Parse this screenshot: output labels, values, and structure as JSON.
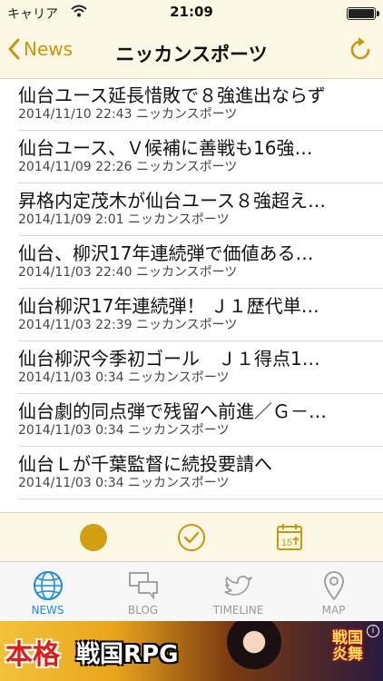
{
  "status": {
    "carrier": "キャリア",
    "time": "21:09"
  },
  "nav": {
    "back_label": "News",
    "title": "ニッカンスポーツ"
  },
  "articles": [
    {
      "headline": "仙台ユース延長惜敗で８強進出ならず",
      "datetime": "2014/11/10 22:43",
      "source": "ニッカンスポーツ"
    },
    {
      "headline": "仙台ユース、Ｖ候補に善戦も16強…",
      "datetime": "2014/11/09 22:26",
      "source": "ニッカンスポーツ"
    },
    {
      "headline": "昇格内定茂木が仙台ユース８強超え…",
      "datetime": "2014/11/09 2:01",
      "source": "ニッカンスポーツ"
    },
    {
      "headline": "仙台、柳沢17年連続弾で価値ある…",
      "datetime": "2014/11/03 22:40",
      "source": "ニッカンスポーツ"
    },
    {
      "headline": "仙台柳沢17年連続弾！ Ｊ１歴代単…",
      "datetime": "2014/11/03 22:39",
      "source": "ニッカンスポーツ"
    },
    {
      "headline": "仙台柳沢今季初ゴール　Ｊ１得点1…",
      "datetime": "2014/11/03 0:34",
      "source": "ニッカンスポーツ"
    },
    {
      "headline": "仙台劇的同点弾で残留へ前進／Ｇ－…",
      "datetime": "2014/11/03 0:34",
      "source": "ニッカンスポーツ"
    },
    {
      "headline": "仙台Ｌが千葉監督に続投要請へ",
      "datetime": "2014/11/03 0:34",
      "source": "ニッカンスポーツ"
    }
  ],
  "toolbar": {
    "calendar_day": "15"
  },
  "tabs": [
    {
      "label": "NEWS",
      "icon": "globe-icon"
    },
    {
      "label": "BLOG",
      "icon": "chat-bubbles-icon"
    },
    {
      "label": "TIMELINE",
      "icon": "twitter-bird-icon"
    },
    {
      "label": "MAP",
      "icon": "map-pin-icon"
    }
  ],
  "ad": {
    "main": "本格",
    "sub": "戦国RPG",
    "logo_line1": "戦国",
    "logo_line2": "炎舞"
  },
  "colors": {
    "accent": "#c9960d",
    "tab_active": "#1a8ae6",
    "bar_bg": "#fdf8e6"
  }
}
